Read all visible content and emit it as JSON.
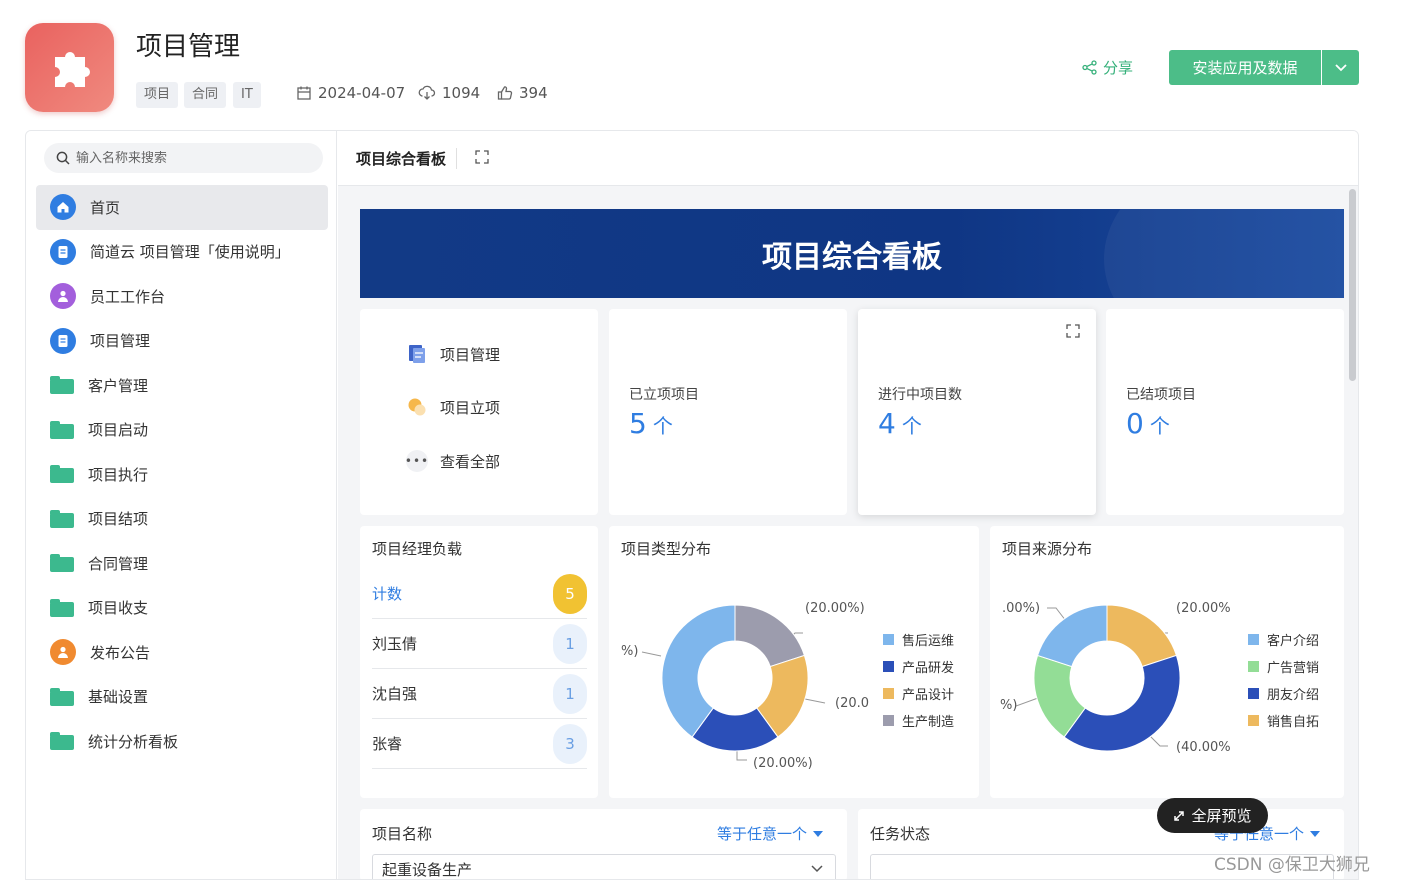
{
  "app": {
    "title": "项目管理",
    "tags": [
      "项目",
      "合同",
      "IT"
    ],
    "date": "2024-04-07",
    "downloads": "1094",
    "likes": "394",
    "share_label": "分享",
    "install_label": "安装应用及数据",
    "logo_color": "#e9625f",
    "accent": "#4cbd88"
  },
  "sidebar": {
    "search_placeholder": "输入名称来搜索",
    "items": [
      {
        "label": "首页",
        "icon": "home-icon",
        "color": "#2f7de1"
      },
      {
        "label": "简道云 项目管理「使用说明」",
        "icon": "document-icon",
        "color": "#2f7de1"
      },
      {
        "label": "员工工作台",
        "icon": "person-icon",
        "color": "#a35fdc"
      },
      {
        "label": "项目管理",
        "icon": "document-icon",
        "color": "#2f7de1"
      },
      {
        "label": "客户管理",
        "icon": "folder-icon",
        "color": "#3cb98e"
      },
      {
        "label": "项目启动",
        "icon": "folder-icon",
        "color": "#3cb98e"
      },
      {
        "label": "项目执行",
        "icon": "folder-icon",
        "color": "#3cb98e"
      },
      {
        "label": "项目结项",
        "icon": "folder-icon",
        "color": "#3cb98e"
      },
      {
        "label": "合同管理",
        "icon": "folder-icon",
        "color": "#3cb98e"
      },
      {
        "label": "项目收支",
        "icon": "folder-icon",
        "color": "#3cb98e"
      },
      {
        "label": "发布公告",
        "icon": "person-icon",
        "color": "#f08a30"
      },
      {
        "label": "基础设置",
        "icon": "folder-icon",
        "color": "#3cb98e"
      },
      {
        "label": "统计分析看板",
        "icon": "folder-icon",
        "color": "#3cb98e"
      }
    ]
  },
  "dashboard": {
    "tab_label": "项目综合看板",
    "banner_title": "项目综合看板",
    "quick_links": [
      "项目管理",
      "项目立项",
      "查看全部"
    ],
    "stats": [
      {
        "label": "已立项项目",
        "value": "5",
        "unit": "个"
      },
      {
        "label": "进行中项目数",
        "value": "4",
        "unit": "个"
      },
      {
        "label": "已结项项目",
        "value": "0",
        "unit": "个"
      }
    ],
    "lead_card": {
      "title": "项目经理负载",
      "header_label": "计数",
      "header_count": "5",
      "rows": [
        {
          "name": "刘玉倩",
          "count": "1"
        },
        {
          "name": "沈自强",
          "count": "1"
        },
        {
          "name": "张睿",
          "count": "3"
        }
      ]
    },
    "type_chart": {
      "title": "项目类型分布",
      "pct_labels": [
        "(20.00%)",
        "(20.0",
        "(20.00%)",
        "%)"
      ],
      "legend": [
        "售后运维",
        "产品研发",
        "产品设计",
        "生产制造"
      ]
    },
    "source_chart": {
      "title": "项目来源分布",
      "pct_labels": [
        "(20.00%",
        "(40.00%",
        ".00%)",
        "%)"
      ],
      "legend": [
        "客户介绍",
        "广告营销",
        "朋友介绍",
        "销售自拓"
      ]
    },
    "filters": [
      {
        "label": "项目名称",
        "op": "等于任意一个",
        "value": "起重设备生产"
      },
      {
        "label": "任务状态",
        "op": "等于任意一个",
        "value": ""
      }
    ],
    "fullscreen_label": "全屏预览"
  },
  "watermark": "CSDN @保卫大狮兄",
  "chart_data": [
    {
      "type": "pie",
      "title": "项目类型分布",
      "categories": [
        "售后运维",
        "产品研发",
        "产品设计",
        "生产制造"
      ],
      "values": [
        40,
        20,
        20,
        20
      ],
      "colors": [
        "#7eb6ec",
        "#2b4fb8",
        "#edb95e",
        "#9c9cad"
      ]
    },
    {
      "type": "pie",
      "title": "项目来源分布",
      "categories": [
        "客户介绍",
        "广告营销",
        "朋友介绍",
        "销售自拓"
      ],
      "values": [
        20,
        20,
        40,
        20
      ],
      "colors": [
        "#7eb6ec",
        "#93dd96",
        "#2b4fb8",
        "#edb95e"
      ]
    }
  ]
}
